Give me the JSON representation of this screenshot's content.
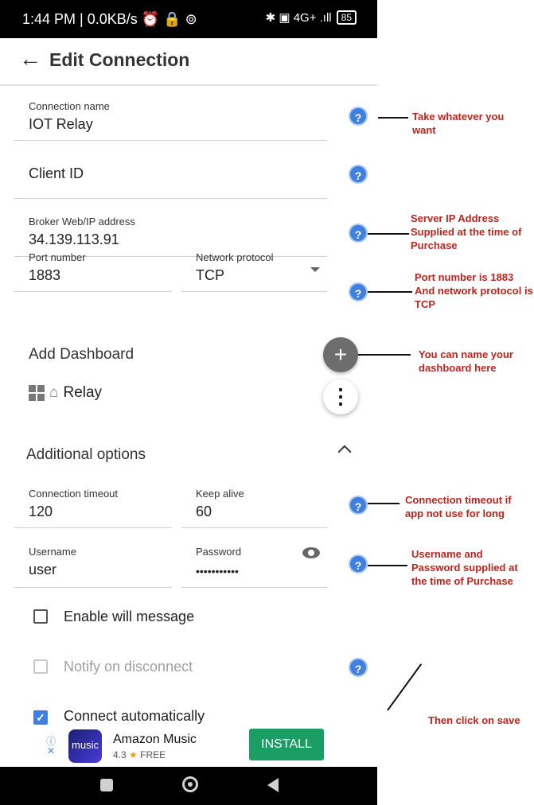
{
  "status_bar": {
    "left_text": "1:44 PM | 0.0KB/s ⏰ 🔒 ⊚",
    "right_text": "✱ ▣ 4G+ .ıll",
    "battery": "85"
  },
  "appbar": {
    "title": "Edit Connection"
  },
  "form": {
    "connection_name": {
      "label": "Connection name",
      "value": "IOT Relay"
    },
    "client_id": {
      "placeholder": "Client ID"
    },
    "broker": {
      "label": "Broker Web/IP address",
      "value": "34.139.113.91"
    },
    "port": {
      "label": "Port number",
      "value": "1883"
    },
    "protocol": {
      "label": "Network protocol",
      "value": "TCP"
    },
    "add_dashboard": "Add Dashboard",
    "dashboard_item": "Relay",
    "additional_options": "Additional options",
    "timeout": {
      "label": "Connection timeout",
      "value": "120"
    },
    "keep_alive": {
      "label": "Keep alive",
      "value": "60"
    },
    "username": {
      "label": "Username",
      "value": "user"
    },
    "password": {
      "label": "Password",
      "value": "•••••••••••"
    },
    "enable_will": {
      "label": "Enable will message",
      "checked": false
    },
    "notify_disconnect": {
      "label": "Notify on disconnect",
      "checked": false
    },
    "connect_auto": {
      "label": "Connect automatically",
      "checked": true
    }
  },
  "help_symbol": "?",
  "fab": {
    "plus": "+",
    "more": "⋮"
  },
  "ad": {
    "info": "ⓘ",
    "close": "✕",
    "logo_text": "music",
    "title": "Amazon Music",
    "rating": "4.3",
    "star": "★",
    "price": "FREE",
    "install": "INSTALL"
  },
  "annotations": {
    "a1": "Take whatever you want",
    "a2": "Server IP Address Supplied at the time of Purchase",
    "a3": "Port number is 1883 And network protocol is TCP",
    "a4": "You can name your dashboard here",
    "a5": "Connection timeout if app not use for long",
    "a6": "Username and Password supplied at the time of Purchase",
    "a7": "Then click on save"
  },
  "colors": {
    "accent": "#3f7fe0",
    "annotation": "#c0231b",
    "install": "#1b9e63"
  }
}
